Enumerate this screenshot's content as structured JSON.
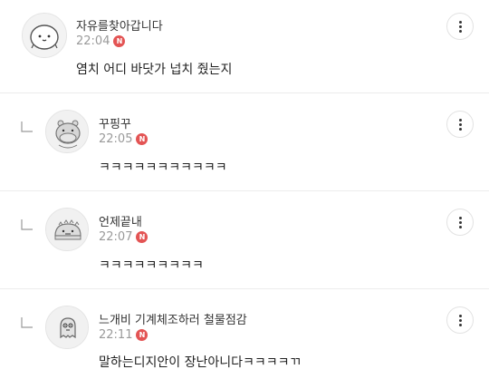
{
  "comments": [
    {
      "author": "자유를찾아갑니다",
      "time": "22:04",
      "badge": "N",
      "text": "염치 어디 바닷가 넙치 줬는지",
      "avatar_icon": "round-face-avatar-icon",
      "is_reply": false
    },
    {
      "author": "꾸핑꾸",
      "time": "22:05",
      "badge": "N",
      "text": "ㅋㅋㅋㅋㅋㅋㅋㅋㅋㅋㅋ",
      "avatar_icon": "hippo-avatar-icon",
      "is_reply": true
    },
    {
      "author": "언제끝내",
      "time": "22:07",
      "badge": "N",
      "text": "ㅋㅋㅋㅋㅋㅋㅋㅋㅋ",
      "avatar_icon": "dino-avatar-icon",
      "is_reply": true
    },
    {
      "author": "느개비 기계체조하러 철물점감",
      "time": "22:11",
      "badge": "N",
      "text": "말하는디지안이 장난아니다ㅋㅋㅋㅋㄲ",
      "avatar_icon": "ghost-avatar-icon",
      "is_reply": true
    }
  ],
  "colors": {
    "badge": "#e35454",
    "time": "#9a9a9a",
    "divider": "#ececec"
  },
  "icons": {
    "more": "more-vertical-icon",
    "reply": "reply-arrow-icon"
  }
}
